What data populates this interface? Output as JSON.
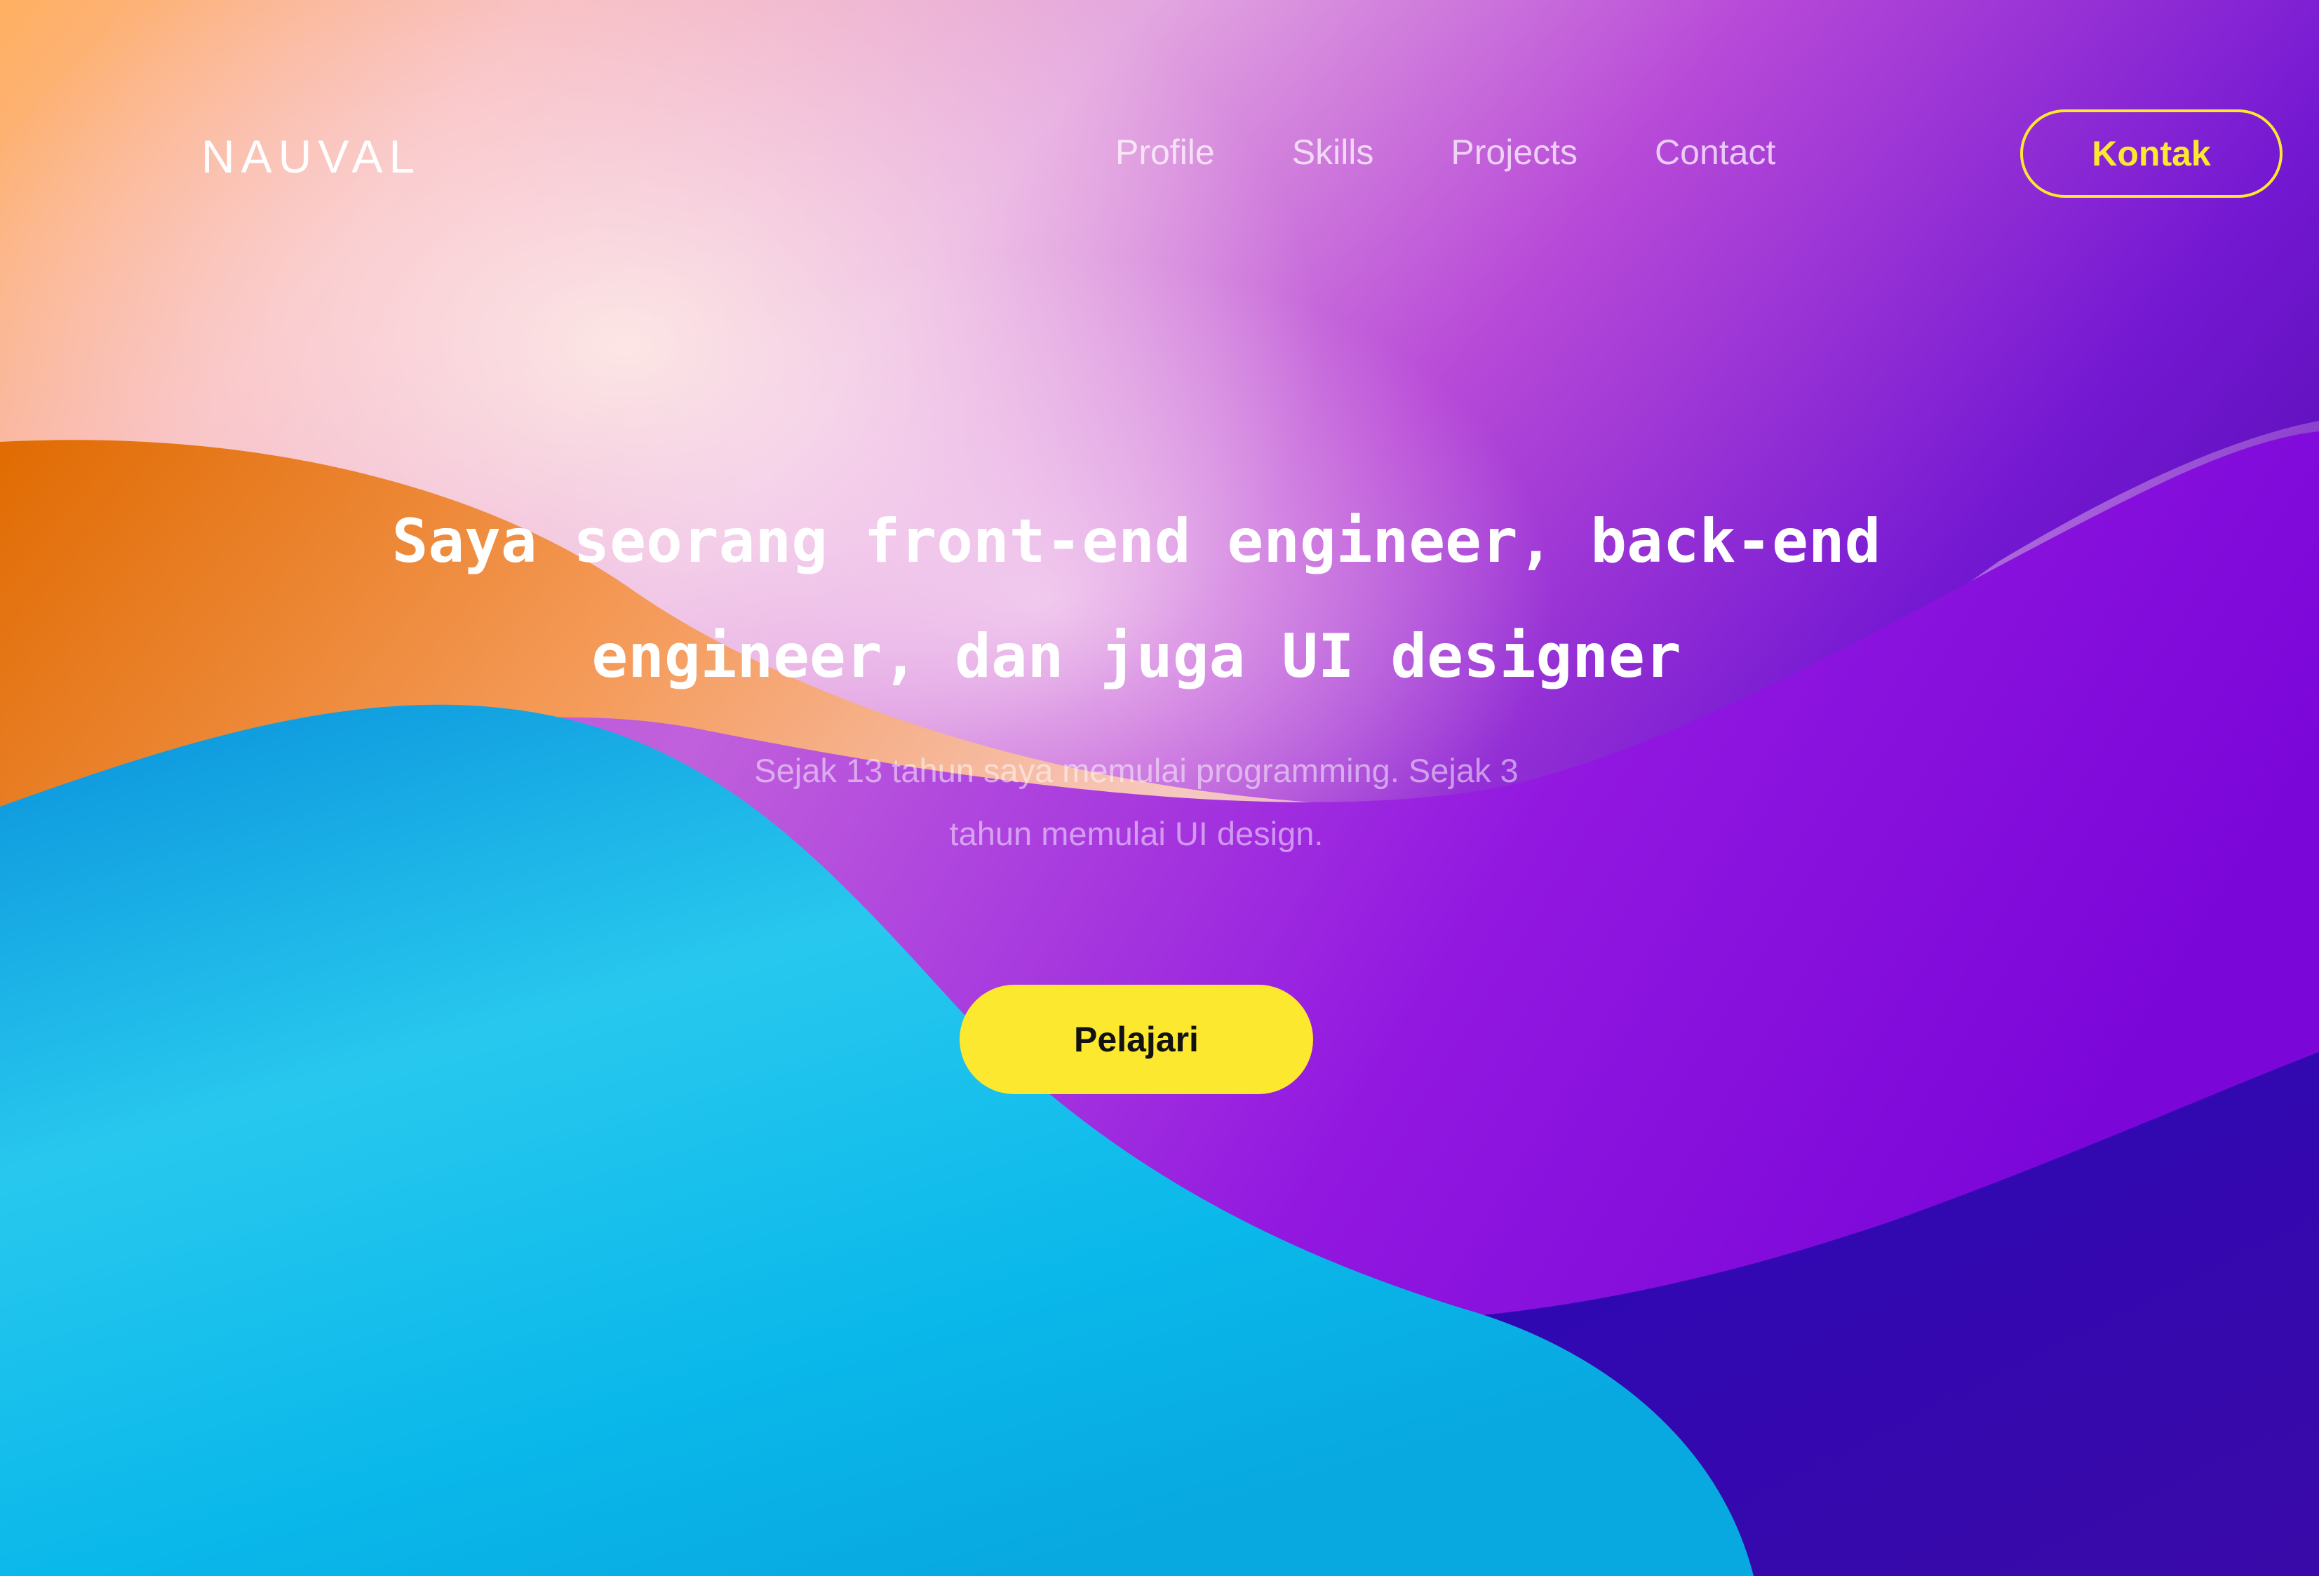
{
  "nav": {
    "logo": "NAUVAL",
    "links": [
      "Profile",
      "Skills",
      "Projects",
      "Contact"
    ],
    "cta_label": "Kontak"
  },
  "hero": {
    "title": "Saya seorang front-end engineer, back-end engineer, dan juga UI designer",
    "subtitle": "Sejak 13 tahun saya memulai programming. Sejak 3 tahun memulai UI design.",
    "cta_label": "Pelajari"
  },
  "colors": {
    "accent_yellow": "#fde830",
    "purple": "#8a14e0",
    "deep_indigo": "#3000b0",
    "cyan": "#12b6ea",
    "orange": "#ff8a20"
  }
}
